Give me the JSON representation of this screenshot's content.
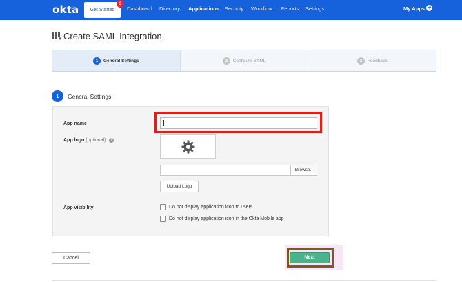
{
  "nav": {
    "brand": "okta",
    "get_started": "Get Started",
    "notification_count": "3",
    "items": [
      {
        "label": "Dashboard",
        "active": false
      },
      {
        "label": "Directory",
        "active": false
      },
      {
        "label": "Applications",
        "active": true
      },
      {
        "label": "Security",
        "active": false
      },
      {
        "label": "Workflow",
        "active": false
      },
      {
        "label": "Reports",
        "active": false
      },
      {
        "label": "Settings",
        "active": false
      }
    ],
    "my_apps": "My Apps",
    "my_apps_icon": "arrow-right-circle-icon"
  },
  "page": {
    "title": "Create SAML Integration",
    "title_icon": "apps-grid-icon"
  },
  "stepper": {
    "steps": [
      {
        "num": "1",
        "label": "General Settings",
        "active": true
      },
      {
        "num": "2",
        "label": "Configure SAML",
        "active": false
      },
      {
        "num": "3",
        "label": "Feedback",
        "active": false
      }
    ]
  },
  "section": {
    "num": "1",
    "title": "General Settings"
  },
  "form": {
    "app_name_label": "App name",
    "app_name_value": "",
    "app_logo_label": "App logo",
    "app_logo_optional": "(optional)",
    "help_glyph": "?",
    "logo_placeholder_icon": "gear-icon",
    "browse_label": "Browse..",
    "upload_label": "Upload Logo",
    "visibility_label": "App visibility",
    "checkbox_1": "Do not display application icon to users",
    "checkbox_2": "Do not display application icon in the Okta Mobile app"
  },
  "actions": {
    "cancel": "Cancel",
    "next": "Next"
  },
  "colors": {
    "brand_blue": "#1662dd",
    "next_green": "#4cb28a",
    "highlight_red": "#dc1f1a",
    "highlight_brown": "#7a5a1e"
  }
}
